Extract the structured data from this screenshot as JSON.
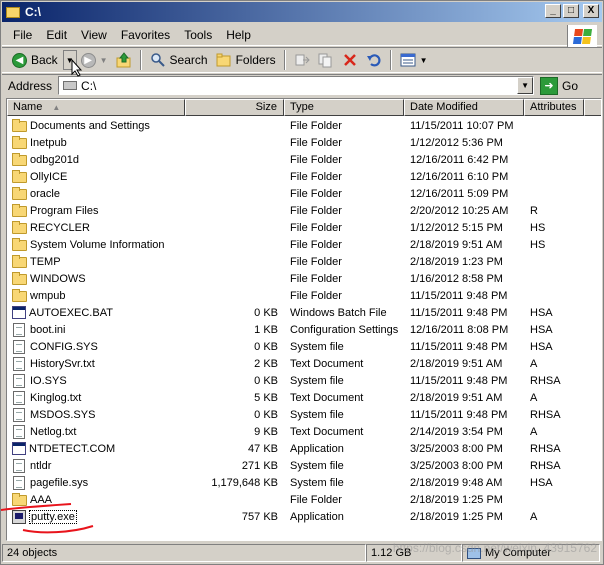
{
  "window": {
    "title": "C:\\",
    "buttons": {
      "minimize": "_",
      "maximize": "□",
      "close": "X"
    }
  },
  "menu": [
    "File",
    "Edit",
    "View",
    "Favorites",
    "Tools",
    "Help"
  ],
  "toolbar": {
    "back_label": "Back",
    "search_label": "Search",
    "folders_label": "Folders"
  },
  "address": {
    "label": "Address",
    "value": "C:\\",
    "go_label": "Go"
  },
  "columns": {
    "name": "Name",
    "size": "Size",
    "type": "Type",
    "modified": "Date Modified",
    "attributes": "Attributes"
  },
  "files": [
    {
      "name": "Documents and Settings",
      "size": "",
      "type": "File Folder",
      "modified": "11/15/2011 10:07 PM",
      "attr": "",
      "icon": "folder"
    },
    {
      "name": "Inetpub",
      "size": "",
      "type": "File Folder",
      "modified": "1/12/2012 5:36 PM",
      "attr": "",
      "icon": "folder"
    },
    {
      "name": "odbg201d",
      "size": "",
      "type": "File Folder",
      "modified": "12/16/2011 6:42 PM",
      "attr": "",
      "icon": "folder"
    },
    {
      "name": "OllyICE",
      "size": "",
      "type": "File Folder",
      "modified": "12/16/2011 6:10 PM",
      "attr": "",
      "icon": "folder"
    },
    {
      "name": "oracle",
      "size": "",
      "type": "File Folder",
      "modified": "12/16/2011 5:09 PM",
      "attr": "",
      "icon": "folder"
    },
    {
      "name": "Program Files",
      "size": "",
      "type": "File Folder",
      "modified": "2/20/2012 10:25 AM",
      "attr": "R",
      "icon": "folder"
    },
    {
      "name": "RECYCLER",
      "size": "",
      "type": "File Folder",
      "modified": "1/12/2012 5:15 PM",
      "attr": "HS",
      "icon": "folder"
    },
    {
      "name": "System Volume Information",
      "size": "",
      "type": "File Folder",
      "modified": "2/18/2019 9:51 AM",
      "attr": "HS",
      "icon": "folder"
    },
    {
      "name": "TEMP",
      "size": "",
      "type": "File Folder",
      "modified": "2/18/2019 1:23 PM",
      "attr": "",
      "icon": "folder"
    },
    {
      "name": "WINDOWS",
      "size": "",
      "type": "File Folder",
      "modified": "1/16/2012 8:58 PM",
      "attr": "",
      "icon": "folder"
    },
    {
      "name": "wmpub",
      "size": "",
      "type": "File Folder",
      "modified": "11/15/2011 9:48 PM",
      "attr": "",
      "icon": "folder"
    },
    {
      "name": "AUTOEXEC.BAT",
      "size": "0 KB",
      "type": "Windows Batch File",
      "modified": "11/15/2011 9:48 PM",
      "attr": "HSA",
      "icon": "app"
    },
    {
      "name": "boot.ini",
      "size": "1 KB",
      "type": "Configuration Settings",
      "modified": "12/16/2011 8:08 PM",
      "attr": "HSA",
      "icon": "file"
    },
    {
      "name": "CONFIG.SYS",
      "size": "0 KB",
      "type": "System file",
      "modified": "11/15/2011 9:48 PM",
      "attr": "HSA",
      "icon": "file"
    },
    {
      "name": "HistorySvr.txt",
      "size": "2 KB",
      "type": "Text Document",
      "modified": "2/18/2019 9:51 AM",
      "attr": "A",
      "icon": "file"
    },
    {
      "name": "IO.SYS",
      "size": "0 KB",
      "type": "System file",
      "modified": "11/15/2011 9:48 PM",
      "attr": "RHSA",
      "icon": "file"
    },
    {
      "name": "Kinglog.txt",
      "size": "5 KB",
      "type": "Text Document",
      "modified": "2/18/2019 9:51 AM",
      "attr": "A",
      "icon": "file"
    },
    {
      "name": "MSDOS.SYS",
      "size": "0 KB",
      "type": "System file",
      "modified": "11/15/2011 9:48 PM",
      "attr": "RHSA",
      "icon": "file"
    },
    {
      "name": "Netlog.txt",
      "size": "9 KB",
      "type": "Text Document",
      "modified": "2/14/2019 3:54 PM",
      "attr": "A",
      "icon": "file"
    },
    {
      "name": "NTDETECT.COM",
      "size": "47 KB",
      "type": "Application",
      "modified": "3/25/2003 8:00 PM",
      "attr": "RHSA",
      "icon": "app"
    },
    {
      "name": "ntldr",
      "size": "271 KB",
      "type": "System file",
      "modified": "3/25/2003 8:00 PM",
      "attr": "RHSA",
      "icon": "file"
    },
    {
      "name": "pagefile.sys",
      "size": "1,179,648 KB",
      "type": "System file",
      "modified": "2/18/2019 9:48 AM",
      "attr": "HSA",
      "icon": "file"
    },
    {
      "name": "AAA",
      "size": "",
      "type": "File Folder",
      "modified": "2/18/2019 1:25 PM",
      "attr": "",
      "icon": "folder"
    },
    {
      "name": "putty.exe",
      "size": "757 KB",
      "type": "Application",
      "modified": "2/18/2019 1:25 PM",
      "attr": "A",
      "icon": "putty"
    }
  ],
  "status": {
    "objects": "24 objects",
    "size": "1.12 GB",
    "location": "My Computer"
  },
  "watermark": "https://blog.csdn.net/weixin_43915762",
  "colors": {
    "titlebar_start": "#0a246a",
    "titlebar_end": "#a6caf0",
    "chrome": "#d4d0c8",
    "annotation": "#e8141c"
  }
}
